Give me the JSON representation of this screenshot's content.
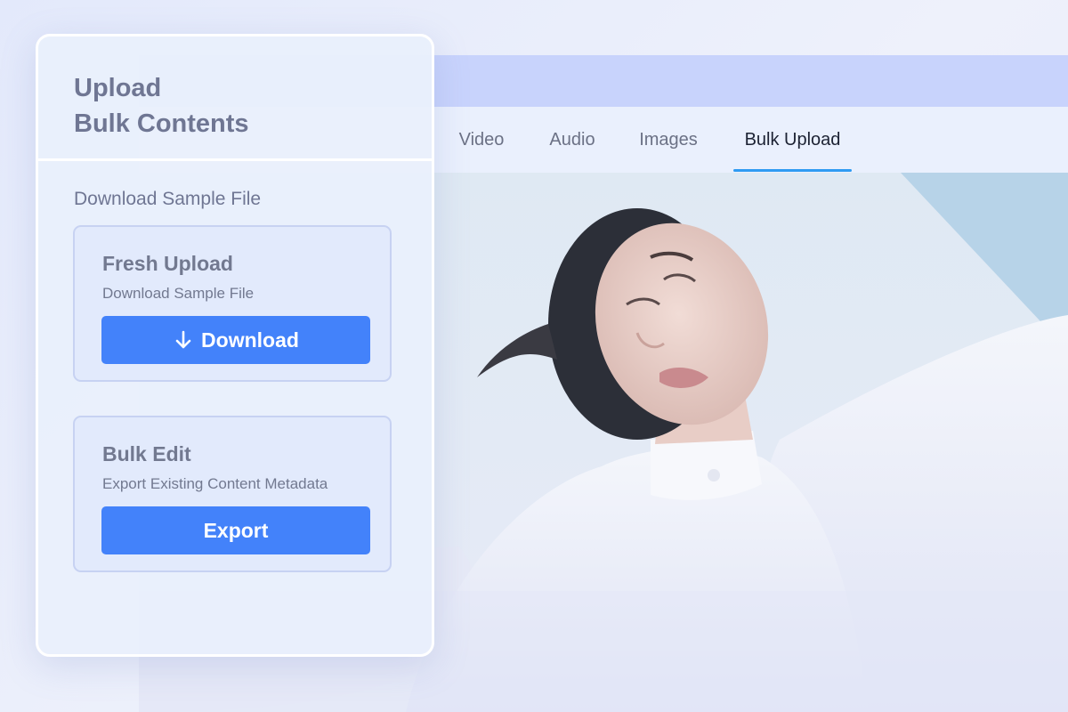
{
  "panel": {
    "title_line1": "Upload",
    "title_line2": "Bulk Contents",
    "section_label": "Download Sample File",
    "cards": [
      {
        "title": "Fresh Upload",
        "subtitle": "Download Sample File",
        "button_label": "Download",
        "button_icon": "arrow-down-icon"
      },
      {
        "title": "Bulk Edit",
        "subtitle": "Export Existing Content Metadata",
        "button_label": "Export"
      }
    ]
  },
  "tabs": [
    {
      "label": "Video"
    },
    {
      "label": "Audio"
    },
    {
      "label": "Images"
    },
    {
      "label": "Bulk Upload",
      "active": true
    }
  ],
  "colors": {
    "accent": "#4382fa",
    "tab_underline": "#2f9bf2",
    "top_bar": "#c8d3fc"
  }
}
